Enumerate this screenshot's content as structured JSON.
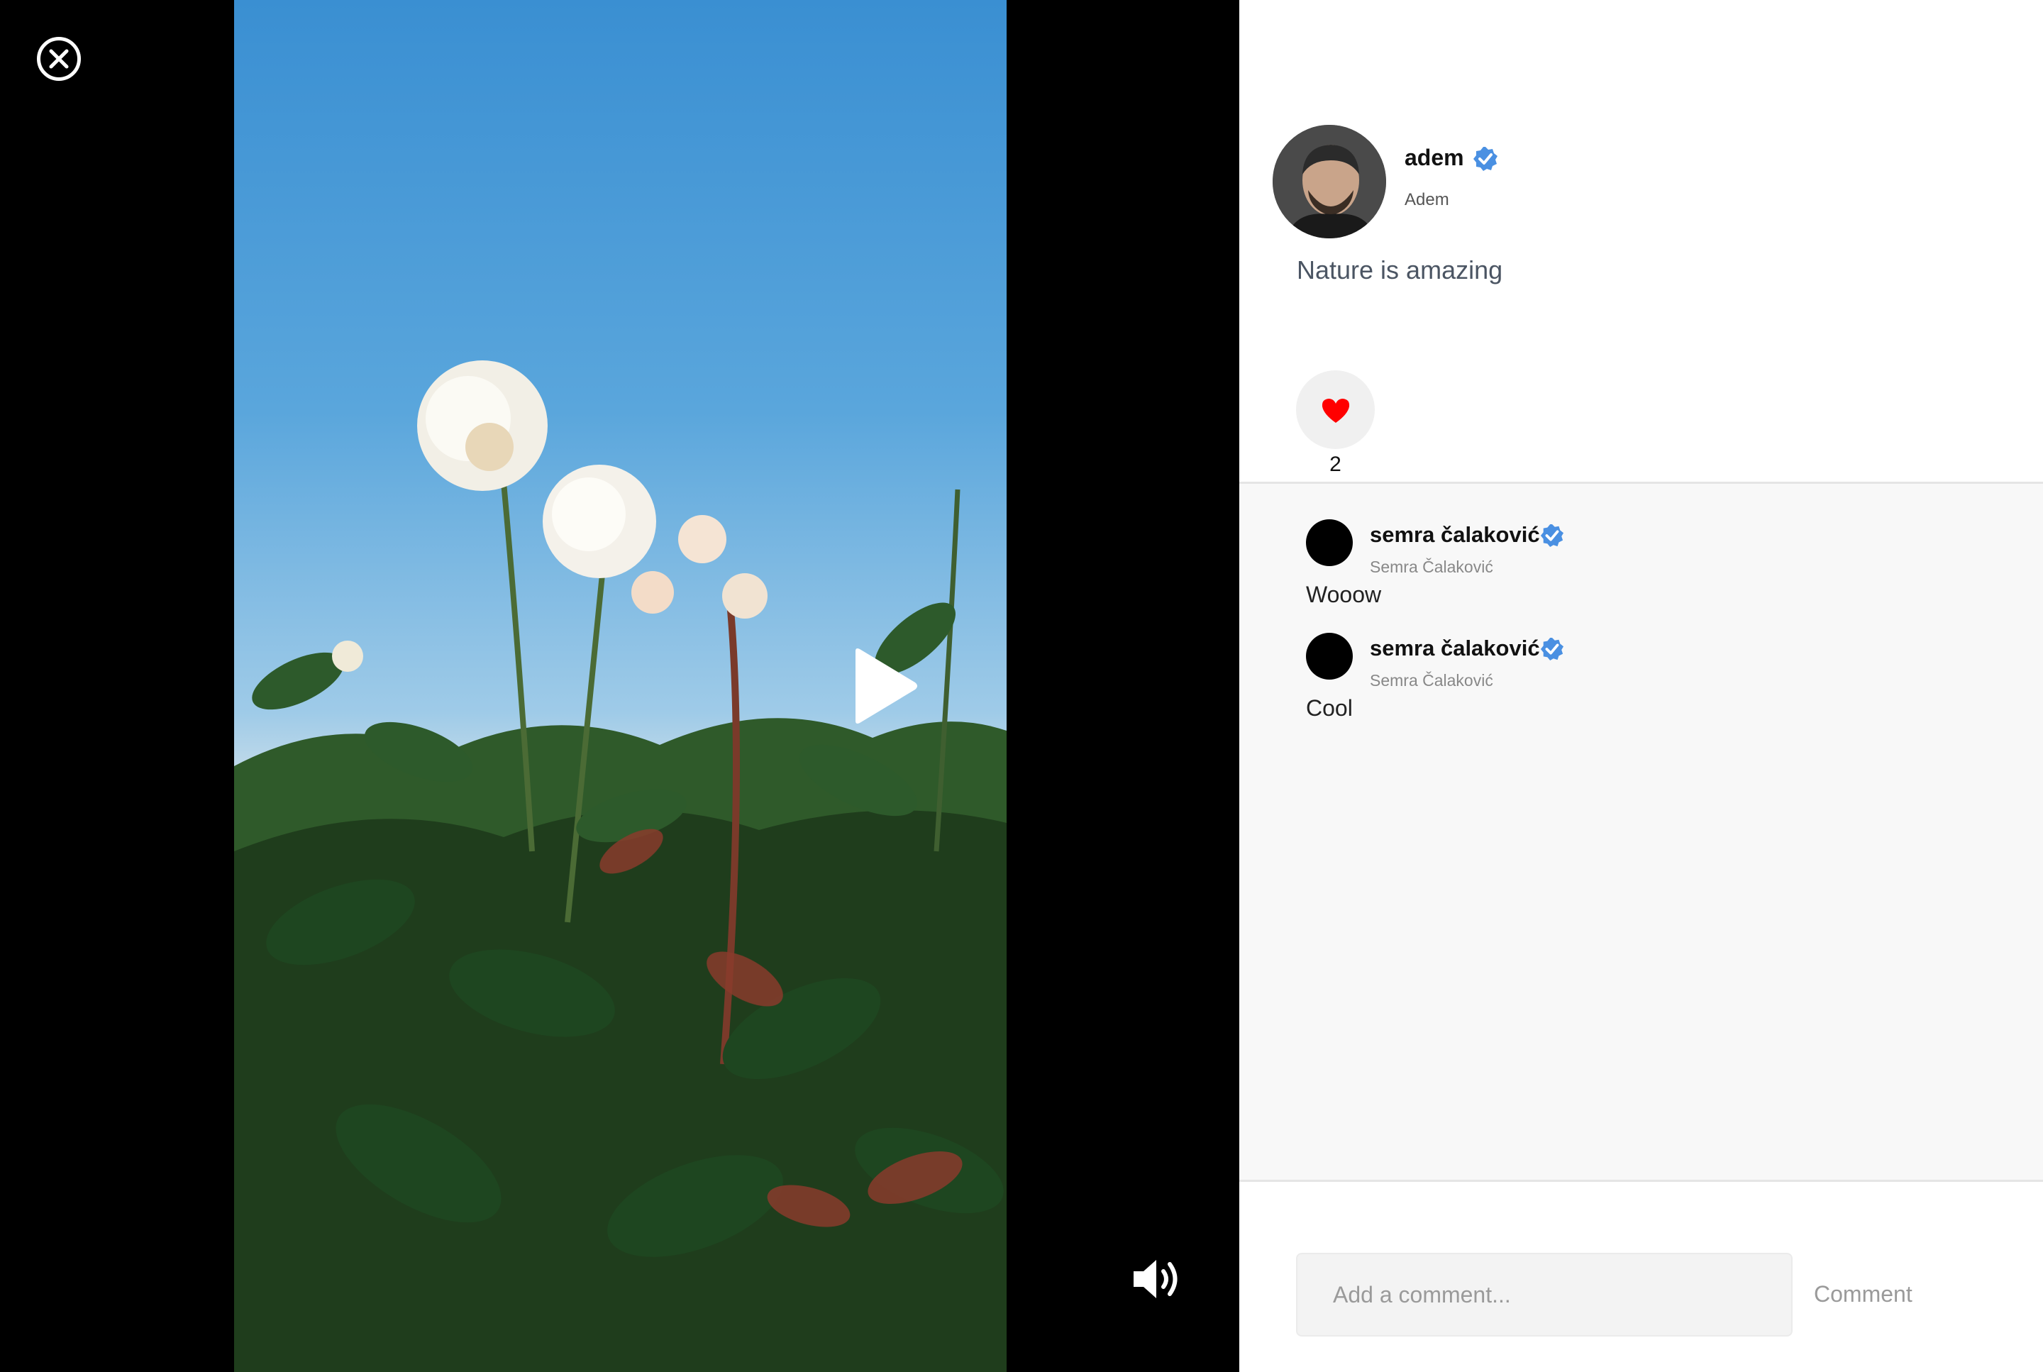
{
  "colors": {
    "stage_bg": "#000000",
    "panel_bg": "#ffffff",
    "comments_bg": "#f8f8f8",
    "verified_blue": "#3b82f6",
    "heart_red": "#ff0000"
  },
  "stage": {
    "close_icon": "close-circle-icon",
    "play_icon": "play-icon",
    "volume_icon": "volume-icon"
  },
  "post": {
    "author_name": "adem",
    "author_display_name": "Adem",
    "author_verified": true,
    "caption": "Nature is amazing",
    "like_icon": "heart-icon",
    "like_count": "2"
  },
  "comments": [
    {
      "name": "semra čalaković",
      "handle": "Semra Čalaković",
      "verified": true,
      "text": "Wooow"
    },
    {
      "name": "semra čalaković",
      "handle": "Semra Čalaković",
      "verified": true,
      "text": "Cool"
    }
  ],
  "composer": {
    "placeholder": "Add a comment...",
    "submit_label": "Comment"
  }
}
